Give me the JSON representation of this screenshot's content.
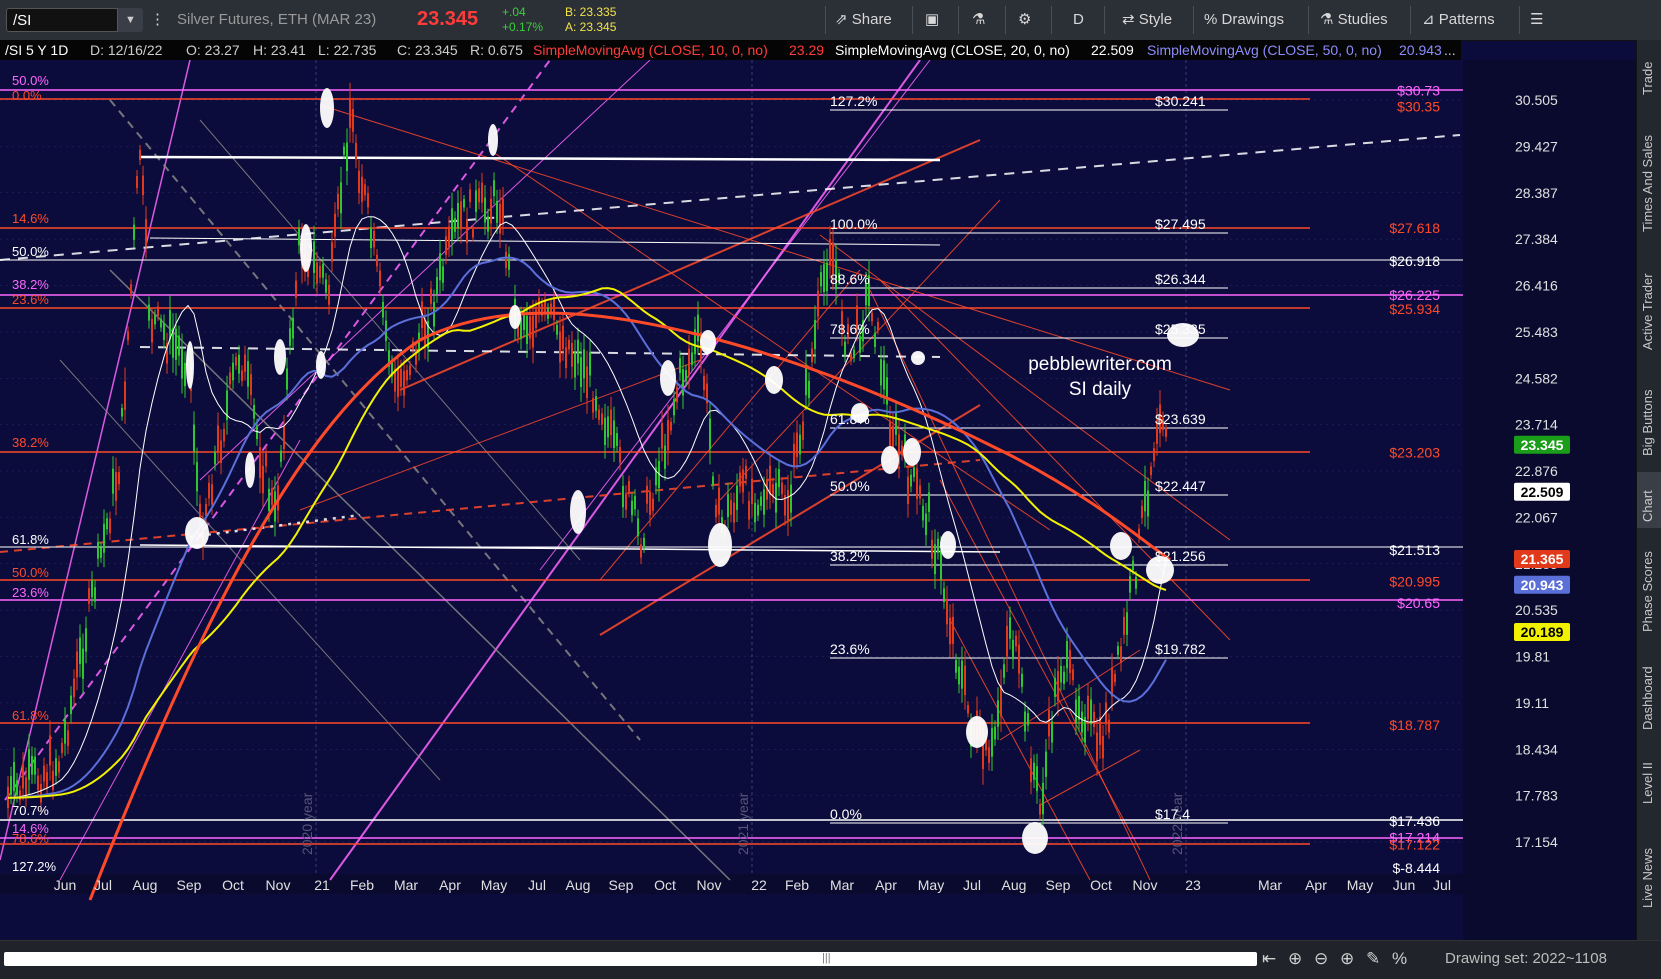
{
  "toolbar": {
    "symbol": "/SI",
    "description": "Silver Futures, ETH (MAR 23)",
    "last_price": "23.345",
    "change": "+.04",
    "change_pct": "+0.17%",
    "bid": "B: 23.335",
    "ask": "A: 23.345",
    "share_label": "Share",
    "period_label": "D",
    "style_label": "Style",
    "drawings_label": "Drawings",
    "studies_label": "Studies",
    "patterns_label": "Patterns",
    "colors": {
      "background": "#0c0c3c",
      "toolbar": "#2b2f36",
      "price": "#ff3b3b",
      "change": "#3ccd3c",
      "bidask": "#f2e34a"
    }
  },
  "infobar": {
    "symbol_period": "/SI 5 Y 1D",
    "date": "D: 12/16/22",
    "open": "O: 23.27",
    "high": "H: 23.41",
    "low": "L: 22.735",
    "close": "C: 23.345",
    "range": "R: 0.675",
    "sma10_label": "SimpleMovingAvg (CLOSE, 10, 0, no)",
    "sma10_value": "23.29",
    "sma20_label": "SimpleMovingAvg (CLOSE, 20, 0, no)",
    "sma20_value": "22.509",
    "sma50_label": "SimpleMovingAvg (CLOSE, 50, 0, no)",
    "sma50_value": "20.943",
    "more": "..."
  },
  "sidebar": {
    "tabs": [
      "Trade",
      "Times And Sales",
      "Active Trader",
      "Big Buttons",
      "Chart",
      "Phase Scores",
      "Dashboard",
      "Level II",
      "Live News"
    ],
    "selected": "Chart"
  },
  "bottombar": {
    "drawing_set": "Drawing set: 2022~1108"
  },
  "chart_data": {
    "type": "line",
    "title": "pebblewriter.com",
    "subtitle": "SI daily",
    "x_axis_labels": [
      "Jun",
      "Jul",
      "Aug",
      "Sep",
      "Oct",
      "Nov",
      "21",
      "Feb",
      "Mar",
      "Apr",
      "May",
      "Jul",
      "Aug",
      "Sep",
      "Oct",
      "Nov",
      "22",
      "Feb",
      "Mar",
      "Apr",
      "May",
      "Jul",
      "Aug",
      "Sep",
      "Oct",
      "Nov",
      "23",
      "Mar",
      "Apr",
      "May",
      "Jun",
      "Jul"
    ],
    "year_labels": [
      "2020 year",
      "2021 year",
      "2022 year"
    ],
    "y_tick_labels": [
      "30.505",
      "29.427",
      "28.387",
      "27.384",
      "26.416",
      "25.483",
      "24.582",
      "23.714",
      "22.876",
      "22.067",
      "21.285",
      "20.535",
      "19.81",
      "19.11",
      "18.434",
      "17.783",
      "17.154"
    ],
    "ylim": [
      17.154,
      30.505
    ],
    "price_badges": [
      {
        "label": "23.345",
        "color": "#1a9e1a"
      },
      {
        "label": "22.509",
        "color": "#ffffff"
      },
      {
        "label": "21.365",
        "color": "#e03a1a"
      },
      {
        "label": "20.943",
        "color": "#5a6fd8"
      },
      {
        "label": "20.189",
        "color": "#f2f200"
      }
    ],
    "fib_levels_center": [
      {
        "pct": "127.2%",
        "price": "$30.241"
      },
      {
        "pct": "100.0%",
        "price": "$27.495"
      },
      {
        "pct": "88.6%",
        "price": "$26.344"
      },
      {
        "pct": "78.6%",
        "price": "$25.335"
      },
      {
        "pct": "61.8%",
        "price": "$23.639"
      },
      {
        "pct": "50.0%",
        "price": "$22.447"
      },
      {
        "pct": "38.2%",
        "price": "$21.256"
      },
      {
        "pct": "23.6%",
        "price": "$19.782"
      },
      {
        "pct": "0.0%",
        "price": "$17.4"
      }
    ],
    "fib_levels_left": [
      {
        "label": "50.0%",
        "color": "#ff66ff"
      },
      {
        "label": "0.0%",
        "color": "#ff4a2a"
      },
      {
        "label": "14.6%",
        "color": "#ff4a2a"
      },
      {
        "label": "50.0%",
        "color": "#ffffff"
      },
      {
        "label": "38.2%",
        "color": "#ff66ff"
      },
      {
        "label": "23.6%",
        "color": "#ff4a2a"
      },
      {
        "label": "38.2%",
        "color": "#ff4a2a"
      },
      {
        "label": "61.8%",
        "color": "#ffffff"
      },
      {
        "label": "50.0%",
        "color": "#ff4a2a"
      },
      {
        "label": "23.6%",
        "color": "#ff66ff"
      },
      {
        "label": "61.8%",
        "color": "#ff4a2a"
      },
      {
        "label": "70.7%",
        "color": "#ffffff"
      },
      {
        "label": "14.6%",
        "color": "#ff66ff"
      },
      {
        "label": "78.6%",
        "color": "#ff4a2a"
      },
      {
        "label": "127.2%",
        "color": "#ffffff"
      }
    ],
    "right_price_labels": [
      {
        "label": "$30.73",
        "value": 30.73,
        "color": "#ff66ff"
      },
      {
        "label": "$30.35",
        "value": 30.35,
        "color": "#ff4a2a"
      },
      {
        "label": "$27.618",
        "value": 27.618,
        "color": "#ff4a2a"
      },
      {
        "label": "$26.918",
        "value": 26.918,
        "color": "#ffffff"
      },
      {
        "label": "$26.225",
        "value": 26.225,
        "color": "#ff66ff"
      },
      {
        "label": "$25.934",
        "value": 25.934,
        "color": "#ff4a2a"
      },
      {
        "label": "$23.203",
        "value": 23.203,
        "color": "#ff4a2a"
      },
      {
        "label": "$21.513",
        "value": 21.513,
        "color": "#ffffff"
      },
      {
        "label": "$20.995",
        "value": 20.995,
        "color": "#ff4a2a"
      },
      {
        "label": "$20.65",
        "value": 20.65,
        "color": "#ff66ff"
      },
      {
        "label": "$18.787",
        "value": 18.787,
        "color": "#ff4a2a"
      },
      {
        "label": "$17.436",
        "value": 17.436,
        "color": "#ffffff"
      },
      {
        "label": "$17.214",
        "value": 17.214,
        "color": "#ff66ff"
      },
      {
        "label": "$17.122",
        "value": 17.122,
        "color": "#ff4a2a"
      },
      {
        "label": "$-8.444",
        "value": null,
        "color": "#ffffff"
      }
    ],
    "sma10_color": "#ffffff",
    "sma20_color": "#f2f200",
    "sma50_color": "#5a6fd8",
    "sma200_color": "#ff4a2a"
  }
}
